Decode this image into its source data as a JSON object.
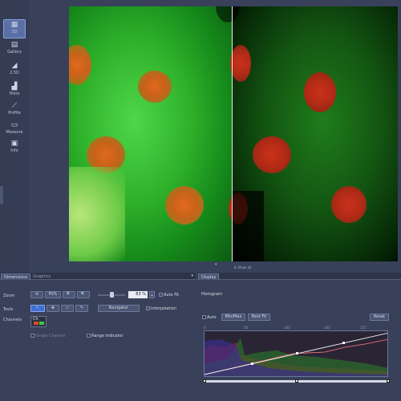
{
  "sidebar": {
    "items": [
      {
        "label": "2D",
        "icon": "grid-icon",
        "glyph": "▦",
        "active": true
      },
      {
        "label": "Gallery",
        "icon": "gallery-icon",
        "glyph": "▤",
        "active": false
      },
      {
        "label": "2.5D",
        "icon": "surface-icon",
        "glyph": "◢",
        "active": false
      },
      {
        "label": "Histo",
        "icon": "histogram-icon",
        "glyph": "▟",
        "active": false
      },
      {
        "label": "Profile",
        "icon": "profile-icon",
        "glyph": "⟋",
        "active": false
      },
      {
        "label": "Measure",
        "icon": "measure-icon",
        "glyph": "▭",
        "active": false
      },
      {
        "label": "Info",
        "icon": "info-icon",
        "glyph": "▣",
        "active": false
      }
    ]
  },
  "viewer": {
    "caption": "& Show all",
    "collapse_glyph": "▾"
  },
  "dimensions_panel": {
    "tabs": [
      {
        "label": "Dimensions",
        "active": true
      },
      {
        "label": "Graphics",
        "active": false
      }
    ],
    "menu_glyph": "▾",
    "zoom": {
      "label": "Zoom",
      "buttons": [
        "⟲",
        "Fit%",
        "🔍",
        "🔍"
      ],
      "value": "83 %",
      "auto_fit_label": "Auto Fit",
      "auto_fit_checked": true
    },
    "tools": {
      "label": "Tools",
      "buttons": [
        "↖",
        "✥",
        "▭",
        "✎"
      ],
      "navigator_label": "Navigator",
      "interpolation_label": "Interpolation",
      "interpolation_checked": true
    },
    "channels": {
      "label": "Channels",
      "chip_text": "Ch",
      "swatch_colors": [
        "#e2472a",
        "#3fc93a"
      ]
    },
    "single_channel_label": "Single Channel",
    "range_indicator_label": "Range Indicator"
  },
  "display_panel": {
    "tabs": [
      {
        "label": "Display",
        "active": true
      }
    ],
    "histogram_title": "Histogram",
    "auto_label": "Auto",
    "min_max_label": "Min/Max",
    "best_fit_label": "Best Fit",
    "reset_label": "Reset",
    "axis_ticks": [
      "0",
      "50",
      "100",
      "200",
      "255"
    ]
  },
  "colors": {
    "accent": "#3f6fd0",
    "panel_bg": "#39415a",
    "tab_active": "#4a5575"
  }
}
